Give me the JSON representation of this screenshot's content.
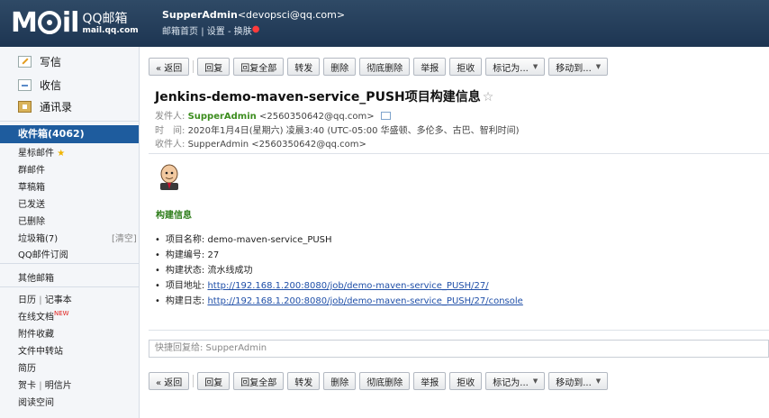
{
  "header": {
    "logo_text": "MOil",
    "logo_cn": "QQ邮箱",
    "logo_domain": "mail.qq.com",
    "user_name": "SupperAdmin",
    "user_email": "<devopsci@qq.com>",
    "link_home": "邮箱首页",
    "link_settings": "设置",
    "link_skin": "换肤"
  },
  "sidebar": {
    "compose": "写信",
    "receive": "收信",
    "contacts": "通讯录",
    "inbox": "收件箱(4062)",
    "starred": "星标邮件",
    "group": "群邮件",
    "drafts": "草稿箱",
    "sent": "已发送",
    "deleted": "已删除",
    "spam": "垃圾箱(7)",
    "spam_clear": "[清空]",
    "subscriptions": "QQ邮件订阅",
    "other": "其他邮箱",
    "calendar": "日历",
    "notes": "记事本",
    "online_docs": "在线文档",
    "new_badge": "NEW",
    "attachments": "附件收藏",
    "file_transfer": "文件中转站",
    "resume": "简历",
    "cards": "贺卡",
    "postcards": "明信片",
    "reading": "阅读空间"
  },
  "toolbar": {
    "back": "« 返回",
    "reply": "回复",
    "reply_all": "回复全部",
    "forward": "转发",
    "delete": "删除",
    "delete_perm": "彻底删除",
    "report": "举报",
    "reject": "拒收",
    "mark_as": "标记为...",
    "move_to": "移动到..."
  },
  "message": {
    "subject": "Jenkins-demo-maven-service_PUSH项目构建信息",
    "from_label": "发件人:",
    "from_name": "SupperAdmin",
    "from_email": "<2560350642@qq.com>",
    "time_label": "时　间:",
    "time_value": "2020年1月4日(星期六) 凌晨3:40 (UTC-05:00 华盛顿、多伦多、古巴、智利时间)",
    "to_label": "收件人:",
    "to_value": "SupperAdmin <2560350642@qq.com>",
    "body_title": "构建信息",
    "items": [
      {
        "label": "项目名称: ",
        "value": "demo-maven-service_PUSH",
        "link": false
      },
      {
        "label": "构建编号: ",
        "value": "27",
        "link": false
      },
      {
        "label": "构建状态: ",
        "value": "流水线成功",
        "link": false
      },
      {
        "label": "项目地址: ",
        "value": "http://192.168.1.200:8080/job/demo-maven-service_PUSH/27/",
        "link": true
      },
      {
        "label": "构建日志: ",
        "value": "http://192.168.1.200:8080/job/demo-maven-service_PUSH/27/console",
        "link": true
      }
    ]
  },
  "quick_reply": {
    "placeholder": "快捷回复给: SupperAdmin"
  }
}
